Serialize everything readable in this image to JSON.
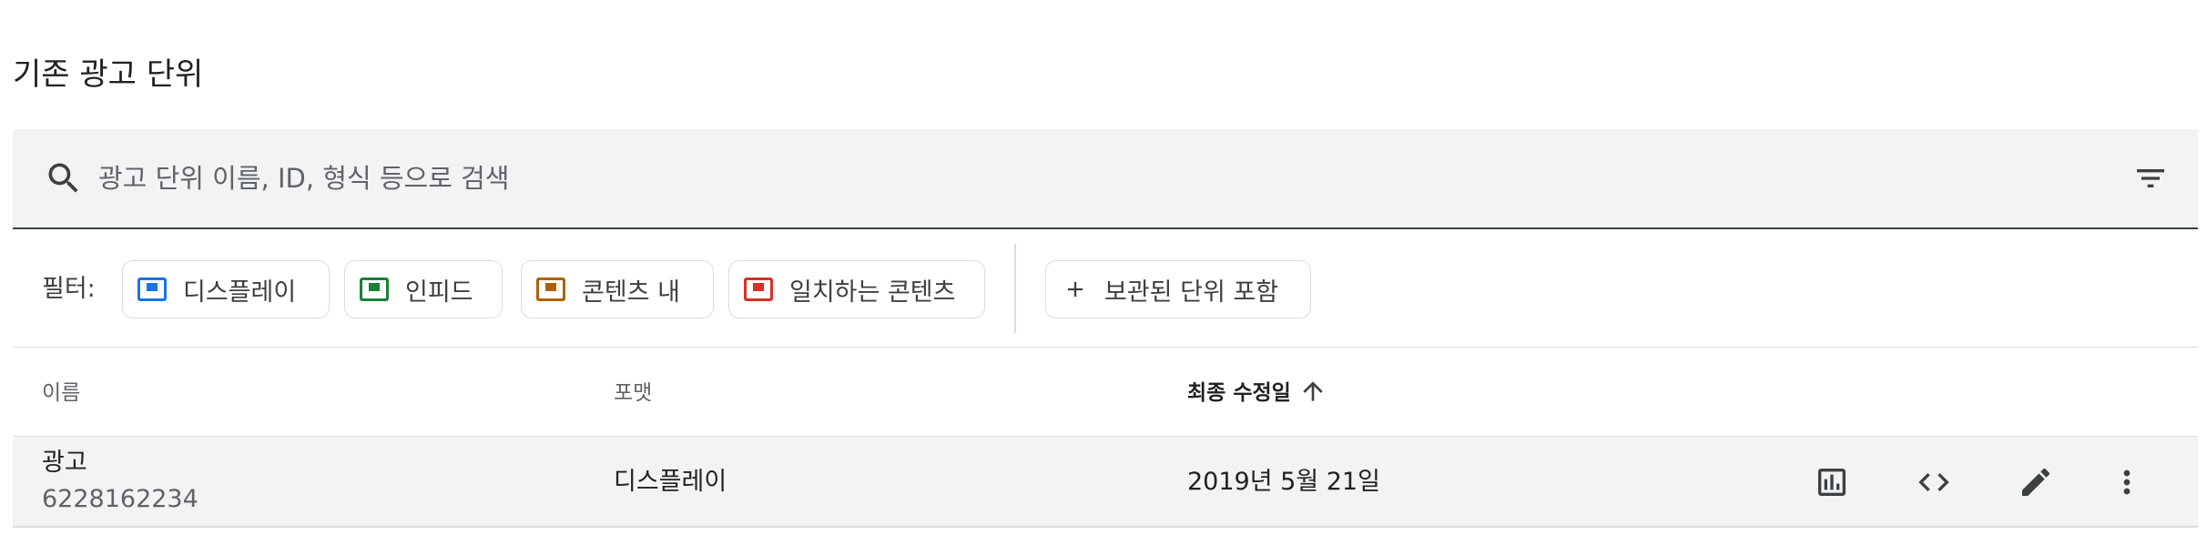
{
  "section": {
    "title": "기존 광고 단위"
  },
  "search": {
    "placeholder": "광고 단위 이름, ID, 형식 등으로 검색",
    "icon": "search-icon",
    "filter_icon": "filter-list-icon"
  },
  "filters": {
    "label": "필터:",
    "chips": [
      {
        "label": "디스플레이",
        "color": "#1a73e8"
      },
      {
        "label": "인피드",
        "color": "#188038"
      },
      {
        "label": "콘텐츠 내",
        "color": "#b06000"
      },
      {
        "label": "일치하는 콘텐츠",
        "color": "#d93025"
      }
    ],
    "archived_label": "보관된 단위 포함"
  },
  "table": {
    "columns": {
      "name": "이름",
      "format": "포맷",
      "modified": "최종 수정일"
    },
    "rows": [
      {
        "name": "광고",
        "id": "6228162234",
        "format": "디스플레이",
        "modified": "2019년 5월 21일"
      }
    ]
  },
  "colors": {
    "accent": "#1a73e8",
    "text": "#202124",
    "muted": "#5f6368"
  }
}
